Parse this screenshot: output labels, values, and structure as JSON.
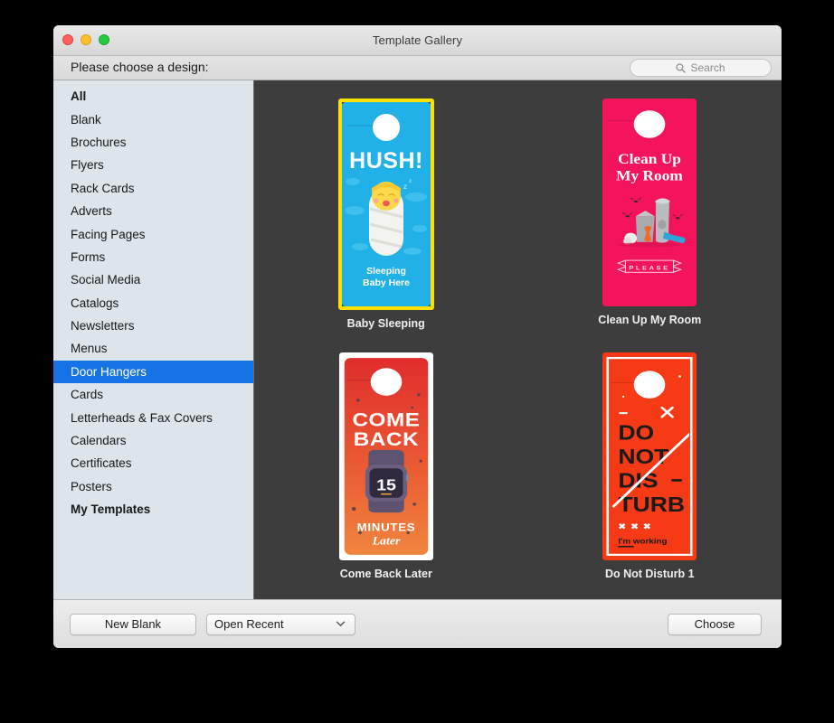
{
  "window": {
    "title": "Template Gallery",
    "traffic_lights": [
      {
        "name": "close",
        "color": "#ff5f57"
      },
      {
        "name": "minimize",
        "color": "#ffbd2e"
      },
      {
        "name": "maximize",
        "color": "#28c840"
      }
    ]
  },
  "toolbar": {
    "prompt": "Please choose a design:",
    "search": {
      "placeholder": "Search",
      "value": "",
      "icon": "search-icon"
    }
  },
  "sidebar": {
    "selected": "Door Hangers",
    "selection_color": "#1673e6",
    "background": "#dde4ea",
    "items": [
      {
        "label": "All",
        "bold": true,
        "selected": false
      },
      {
        "label": "Blank",
        "bold": false,
        "selected": false
      },
      {
        "label": "Brochures",
        "bold": false,
        "selected": false
      },
      {
        "label": "Flyers",
        "bold": false,
        "selected": false
      },
      {
        "label": "Rack Cards",
        "bold": false,
        "selected": false
      },
      {
        "label": "Adverts",
        "bold": false,
        "selected": false
      },
      {
        "label": "Facing Pages",
        "bold": false,
        "selected": false
      },
      {
        "label": "Forms",
        "bold": false,
        "selected": false
      },
      {
        "label": "Social Media",
        "bold": false,
        "selected": false
      },
      {
        "label": "Catalogs",
        "bold": false,
        "selected": false
      },
      {
        "label": "Newsletters",
        "bold": false,
        "selected": false
      },
      {
        "label": "Menus",
        "bold": false,
        "selected": false
      },
      {
        "label": "Door Hangers",
        "bold": false,
        "selected": true
      },
      {
        "label": "Cards",
        "bold": false,
        "selected": false
      },
      {
        "label": "Letterheads & Fax Covers",
        "bold": false,
        "selected": false
      },
      {
        "label": "Calendars",
        "bold": false,
        "selected": false
      },
      {
        "label": "Certificates",
        "bold": false,
        "selected": false
      },
      {
        "label": "Posters",
        "bold": false,
        "selected": false
      },
      {
        "label": "My Templates",
        "bold": true,
        "selected": false
      }
    ]
  },
  "gallery": {
    "background": "#3d3d3d",
    "selection_border_color": "#ffe100",
    "templates": [
      {
        "caption": "Baby Sleeping",
        "selected": true,
        "bg": "#22b1e6",
        "headline": "HUSH!",
        "subline1": "Sleeping",
        "subline2": "Baby Here"
      },
      {
        "caption": "Clean Up My Room",
        "selected": false,
        "bg": "#f4145b",
        "headline1": "Clean Up",
        "headline2": "My Room",
        "banner": "PLEASE"
      },
      {
        "caption": "Come Back Later",
        "selected": false,
        "bg_top": "#e02d2d",
        "bg_bottom": "#f0803c",
        "headline1": "COME",
        "headline2": "BACK",
        "watch_number": "15",
        "footer1": "MINUTES",
        "footer2": "Later"
      },
      {
        "caption": "Do Not Disturb 1",
        "selected": false,
        "bg": "#f63a16",
        "line1": "DO",
        "line2": "NOT",
        "line3": "DIS",
        "line4": "TURB",
        "marks": "✖ ✖ ✖",
        "footer": "I'm working"
      }
    ]
  },
  "bottom_bar": {
    "new_blank_label": "New Blank",
    "open_recent_label": "Open Recent",
    "choose_label": "Choose",
    "chevron_icon": "chevron-down-icon"
  }
}
